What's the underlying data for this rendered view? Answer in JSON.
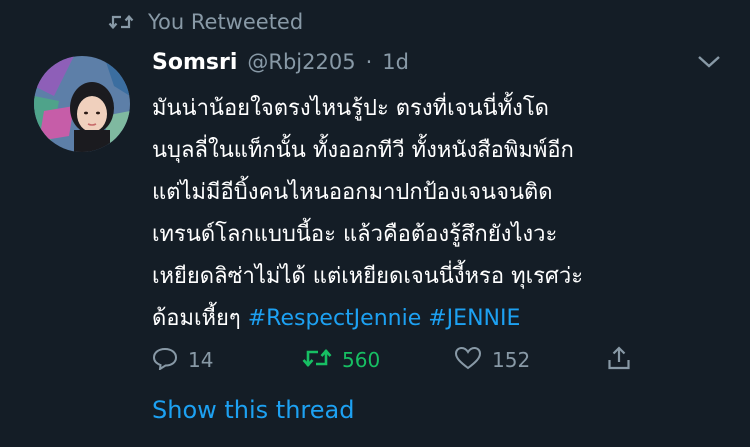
{
  "retweet_banner": {
    "label": "You Retweeted",
    "icon": "retweet-icon"
  },
  "tweet": {
    "author_name": "Somsri",
    "author_handle": "@Rbj2205",
    "separator": "·",
    "time": "1d",
    "text_lines": [
      "มันน่าน้อยใจตรงไหนรู้ปะ ตรงที่เจนนี่ทั้งโด",
      "นบุลลี่ในแท็กนั้น ทั้งออกทีวี ทั้งหนังสือพิมพ์อีก",
      "แต่ไม่มีอีบิ้งคนไหนออกมาปกป้องเจนจนติด",
      "เทรนด์โลกแบบนี้อะ แล้วคือต้องรู้สึกยังไงวะ",
      "เหยียดลิซ่าไม่ได้ แต่เหยียดเจนนี่งี้หรอ ทุเรศว่ะ"
    ],
    "last_line_text": "ด้อมเหี้ยๆ",
    "hashtags": [
      "#RespectJennie",
      "#JENNIE"
    ]
  },
  "actions": {
    "reply_count": "14",
    "retweet_count": "560",
    "like_count": "152"
  },
  "show_thread_label": "Show this thread",
  "colors": {
    "background": "#141d26",
    "text": "#ffffff",
    "muted": "#8899a6",
    "link": "#1da1f2",
    "retweet_active": "#17bf63"
  }
}
